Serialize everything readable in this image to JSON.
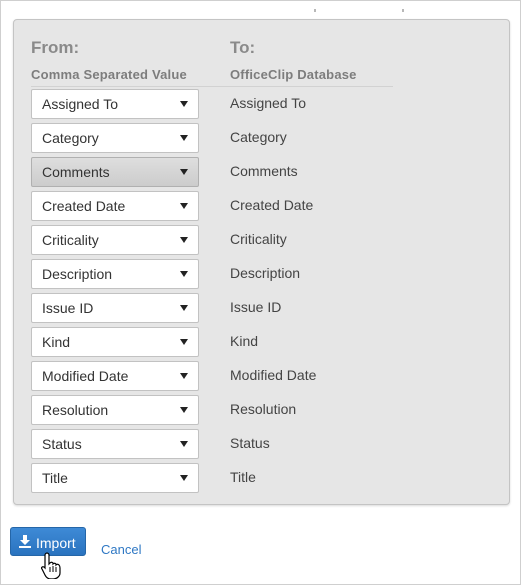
{
  "mapping": {
    "from_header": "From:",
    "to_header": "To:",
    "from_subheader": "Comma Separated Value",
    "to_subheader": "OfficeClip Database",
    "rows": [
      {
        "source": "Assigned To",
        "target": "Assigned To",
        "active": false
      },
      {
        "source": "Category",
        "target": "Category",
        "active": false
      },
      {
        "source": "Comments",
        "target": "Comments",
        "active": true
      },
      {
        "source": "Created Date",
        "target": "Created Date",
        "active": false
      },
      {
        "source": "Criticality",
        "target": "Criticality",
        "active": false
      },
      {
        "source": "Description",
        "target": "Description",
        "active": false
      },
      {
        "source": "Issue ID",
        "target": "Issue ID",
        "active": false
      },
      {
        "source": "Kind",
        "target": "Kind",
        "active": false
      },
      {
        "source": "Modified Date",
        "target": "Modified Date",
        "active": false
      },
      {
        "source": "Resolution",
        "target": "Resolution",
        "active": false
      },
      {
        "source": "Status",
        "target": "Status",
        "active": false
      },
      {
        "source": "Title",
        "target": "Title",
        "active": false
      }
    ]
  },
  "actions": {
    "import_label": "Import",
    "import_icon": "download-icon",
    "cancel_label": "Cancel"
  },
  "cursor_icon": "hand-pointer-icon",
  "colors": {
    "panel_bg": "#e6e6e6",
    "primary_button": "#2f7dcb",
    "link": "#2f78c4",
    "header_text": "#8a8a8a"
  }
}
